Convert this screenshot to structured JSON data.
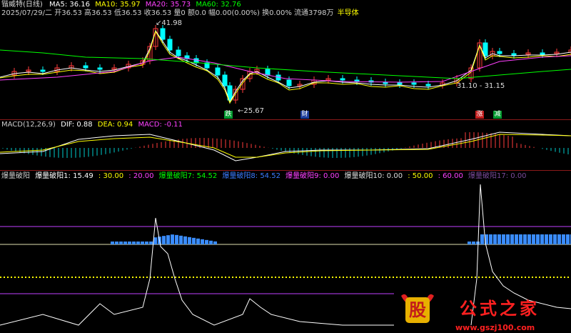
{
  "stock": {
    "name": "锴威特(日线)",
    "ma5": "MA5: 36.16",
    "ma10": "MA10: 35.97",
    "ma20": "MA20: 35.73",
    "ma60": "MA60: 32.76",
    "date": "2025/07/29/二",
    "quote": "开36.53 高36.53 低36.53 收36.53 量0 额0.0 幅0.00(0.00%) 换0.00% 流通3798万",
    "sector": "半导体",
    "high_label": "41.98",
    "low_label": "25.67",
    "range_label": "31.10 - 31.15",
    "markers": {
      "die": "跌",
      "cai": "财",
      "zhang": "涨",
      "jian": "减"
    }
  },
  "macd": {
    "title": "MACD(12,26,9)",
    "dif": "DIF: 0.88",
    "dea": "DEA: 0.94",
    "macd": "MACD: -0.11"
  },
  "indicator": {
    "title": "爆量破阳",
    "v1": "爆量破阳1: 15.49",
    "v2": ": 30.00",
    "v3": ": 20.00",
    "v4": "爆量破阳7: 54.52",
    "v5": "爆量破阳8: 54.52",
    "v6": "爆量破阳9: 0.00",
    "v7": "爆量破阳10: 0.00",
    "v8": ": 50.00",
    "v9": ": 60.00",
    "v10": "爆量破阳17: 0.00"
  },
  "watermark": {
    "logo": "股",
    "text": "公式之家",
    "url": "www.gszj100.com"
  },
  "colors": {
    "up": "#ff3b3b",
    "down": "#00ffff",
    "ma5": "#ffffff",
    "ma10": "#ffff00",
    "ma20": "#ff40ff",
    "ma60": "#00ff00",
    "sep": "#8b1a1a"
  }
}
